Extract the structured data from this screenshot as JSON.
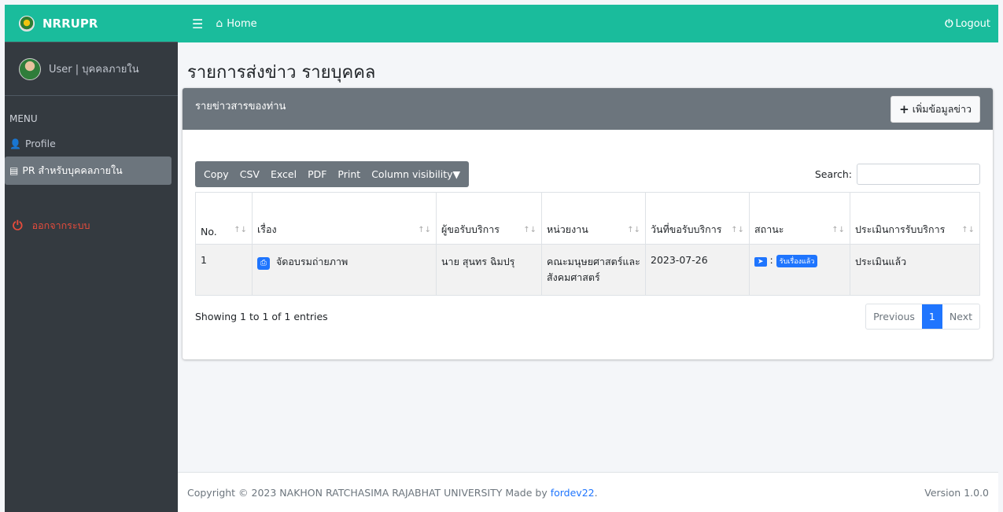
{
  "brand": {
    "name": "NRRUPR"
  },
  "user": {
    "name": "User | บุคคลภายใน"
  },
  "sidebar": {
    "menu_header": "MENU",
    "items": [
      {
        "label": "Profile",
        "icon": "user-icon"
      },
      {
        "label": "PR สำหรับบุคคลภายใน",
        "icon": "table-icon"
      }
    ],
    "logout_label": "ออกจากระบบ"
  },
  "topbar": {
    "home_label": "Home",
    "logout_label": "Logout"
  },
  "page": {
    "title": "รายการส่งข่าว รายบุคคล"
  },
  "card": {
    "header_title": "รายข่าวสารของท่าน",
    "add_button": "เพิ่มข้อมูลข่าว"
  },
  "toolbar": {
    "buttons": [
      "Copy",
      "CSV",
      "Excel",
      "PDF",
      "Print",
      "Column visibility▼"
    ],
    "search_label": "Search:"
  },
  "table": {
    "headers": [
      "No.",
      "เรื่อง",
      "ผู้ขอรับบริการ",
      "หน่วยงาน",
      "วันที่ขอรับบริการ",
      "สถานะ",
      "ประเมินการรับบริการ"
    ],
    "rows": [
      {
        "no": "1",
        "subject": "จัดอบรมถ่ายภาพ",
        "requester": "นาย สุนทร ฉิมปรุ",
        "department": "คณะมนุษยศาสตร์และสังคมศาสตร์",
        "date": "2023-07-26",
        "status": "รับเรื่องแล้ว",
        "evaluation": "ประเมินแล้ว"
      }
    ]
  },
  "pagination": {
    "info": "Showing 1 to 1 of 1 entries",
    "previous": "Previous",
    "current": "1",
    "next": "Next"
  },
  "footer": {
    "copyright": "Copyright © 2023 NAKHON RATCHASIMA RAJABHAT UNIVERSITY Made by",
    "link": "fordev22",
    "version": "Version 1.0.0"
  },
  "colors": {
    "brand": "#1abc9c",
    "sidebar": "#343a40",
    "primary": "#1f75fe",
    "header_gray": "#6c757d"
  }
}
